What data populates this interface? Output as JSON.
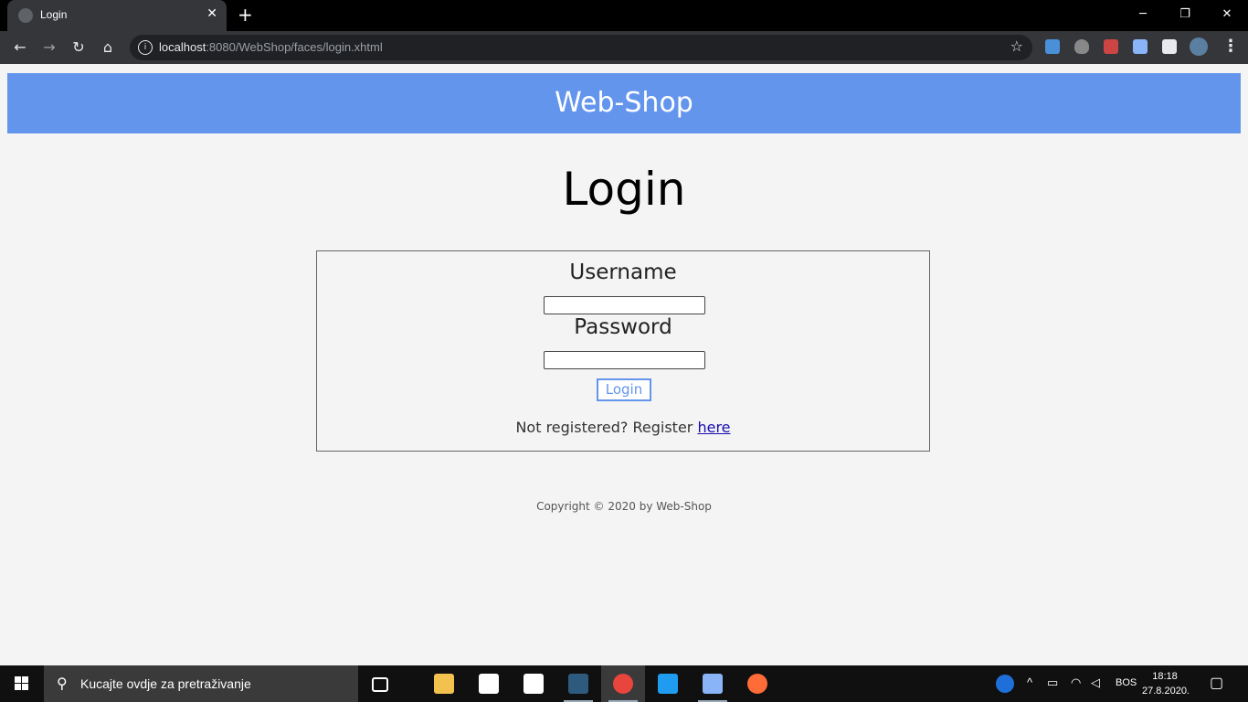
{
  "browser": {
    "tab_title": "Login",
    "new_tab": "+",
    "url_host": "localhost",
    "url_path": ":8080/WebShop/faces/login.xhtml"
  },
  "site": {
    "header_title": "Web-Shop",
    "page_title": "Login",
    "username_label": "Username",
    "username_value": "",
    "password_label": "Password",
    "password_value": "",
    "login_button": "Login",
    "register_prefix": "Not registered? Register ",
    "register_link": "here",
    "copyright": "Copyright © 2020 by Web-Shop"
  },
  "taskbar": {
    "search_placeholder": "Kucajte ovdje za pretraživanje",
    "language": "BOS",
    "time": "18:18",
    "date": "27.8.2020."
  },
  "colors": {
    "header_bg": "#6495ed",
    "accent": "#6495ed"
  }
}
